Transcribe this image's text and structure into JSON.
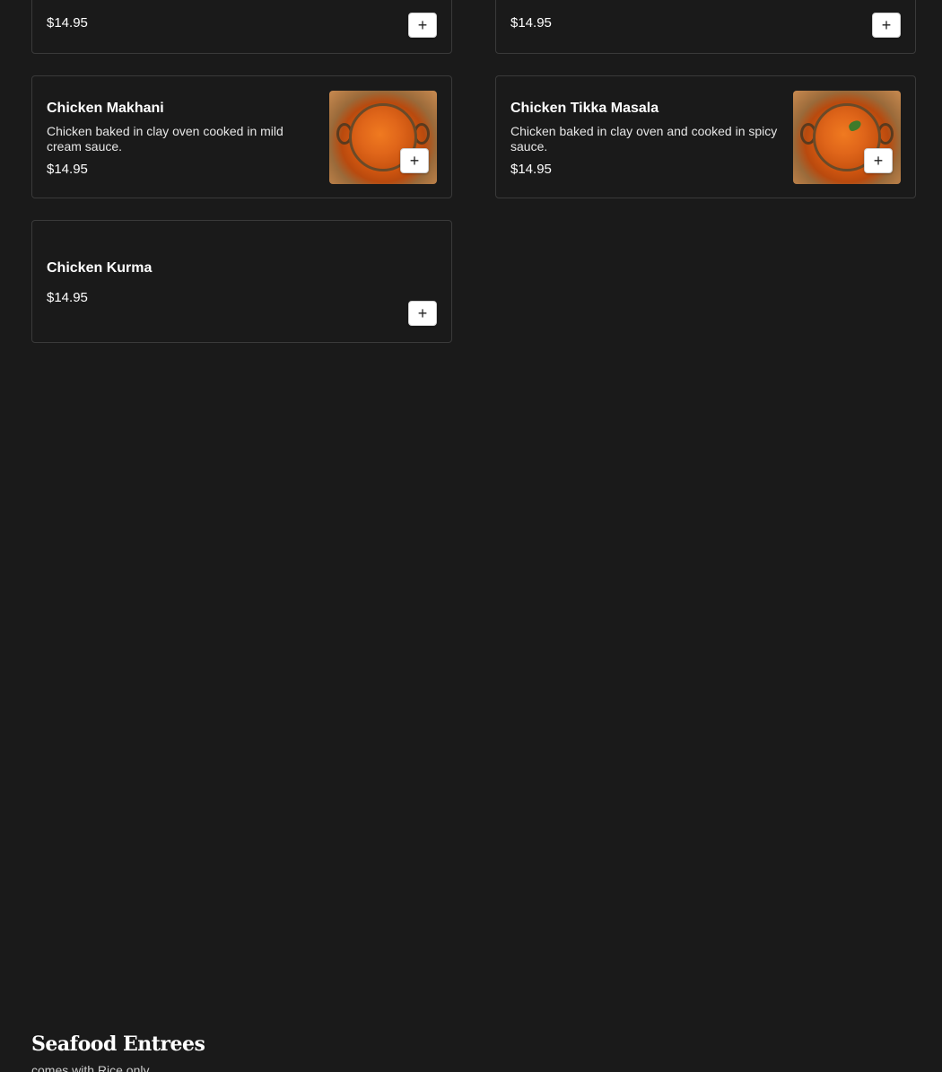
{
  "menu_items": [
    {
      "name": "",
      "description": "",
      "price": "$14.95"
    },
    {
      "name": "",
      "description": "",
      "price": "$14.95"
    },
    {
      "name": "Chicken Makhani",
      "description": "Chicken baked in clay oven cooked in mild cream sauce.",
      "price": "$14.95",
      "has_image": true
    },
    {
      "name": "Chicken Tikka Masala",
      "description": "Chicken baked in clay oven and cooked in spicy sauce.",
      "price": "$14.95",
      "has_image": true
    },
    {
      "name": "Chicken Kurma",
      "description": "",
      "price": "$14.95"
    }
  ],
  "add_button": {
    "icon": "plus-icon",
    "glyph": "+"
  },
  "section": {
    "title": "Seafood Entrees",
    "subtitle": "comes with Rice only"
  },
  "colors": {
    "background": "#1a1a1a",
    "card_border": "#3a3a3a",
    "text": "#ffffff",
    "button_bg": "#ffffff"
  }
}
